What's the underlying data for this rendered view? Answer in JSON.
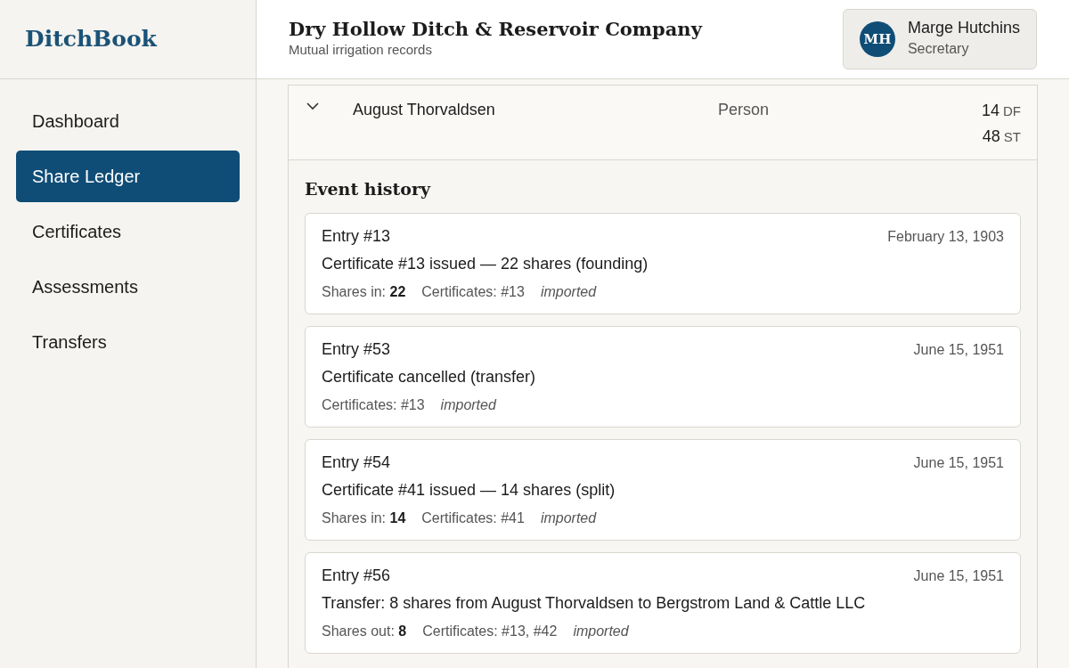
{
  "app": {
    "logo": "DitchBook"
  },
  "sidebar": {
    "items": [
      {
        "label": "Dashboard",
        "selected": false
      },
      {
        "label": "Share Ledger",
        "selected": true
      },
      {
        "label": "Certificates",
        "selected": false
      },
      {
        "label": "Assessments",
        "selected": false
      },
      {
        "label": "Transfers",
        "selected": false
      }
    ]
  },
  "header": {
    "title": "Dry Hollow Ditch & Reservoir Company",
    "subtitle": "Mutual irrigation records",
    "user": {
      "initials": "MH",
      "name": "Marge Hutchins",
      "role": "Secretary"
    }
  },
  "holder": {
    "expanded": true,
    "name": "August Thorvaldsen",
    "type": "Person",
    "holdings": [
      {
        "value": "14",
        "unit": "DF"
      },
      {
        "value": "48",
        "unit": "ST"
      }
    ]
  },
  "event_history": {
    "title": "Event history",
    "entries": [
      {
        "entry": "Entry #13",
        "date": "February 13, 1903",
        "description": "Certificate #13 issued — 22 shares (founding)",
        "meta": [
          {
            "kind": "field",
            "text": "Shares in: **22**"
          },
          {
            "kind": "field",
            "text": "Certificates: #13"
          },
          {
            "kind": "tag",
            "text": "imported"
          }
        ]
      },
      {
        "entry": "Entry #53",
        "date": "June 15, 1951",
        "description": "Certificate cancelled (transfer)",
        "meta": [
          {
            "kind": "field",
            "text": "Certificates: #13"
          },
          {
            "kind": "tag",
            "text": "imported"
          }
        ]
      },
      {
        "entry": "Entry #54",
        "date": "June 15, 1951",
        "description": "Certificate #41 issued — 14 shares (split)",
        "meta": [
          {
            "kind": "field",
            "text": "Shares in: **14**"
          },
          {
            "kind": "field",
            "text": "Certificates: #41"
          },
          {
            "kind": "tag",
            "text": "imported"
          }
        ]
      },
      {
        "entry": "Entry #56",
        "date": "June 15, 1951",
        "description": "Transfer: 8 shares from August Thorvaldsen to Bergstrom Land & Cattle LLC",
        "meta": [
          {
            "kind": "field",
            "text": "Shares out: **8**"
          },
          {
            "kind": "field",
            "text": "Certificates: #13, #42"
          },
          {
            "kind": "tag",
            "text": "imported"
          }
        ]
      }
    ]
  }
}
